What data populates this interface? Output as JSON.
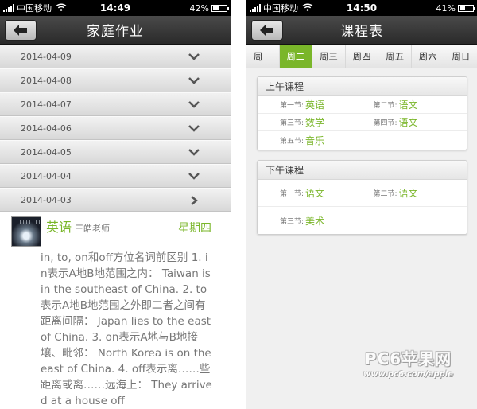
{
  "homework_screen": {
    "status": {
      "carrier": "中国移动",
      "time": "14:49",
      "battery": "42%",
      "battery_level": 0.42
    },
    "title": "家庭作业",
    "dates": [
      "2014-04-09",
      "2014-04-08",
      "2014-04-07",
      "2014-04-06",
      "2014-04-05",
      "2014-04-04",
      "2014-04-03"
    ],
    "detail": {
      "subject": "英语",
      "teacher": "王皓老师",
      "weekday": "星期四",
      "text": "in, to, on和off方位名词前区别 1. in表示A地B地范围之内： Taiwan is in the southeast of China. 2. to表示A地B地范围之外即二者之间有距离间隔： Japan lies to the east of China. 3. on表示A地与B地接壤、毗邻： North Korea is on the east of China. 4. off表示离……些距离或离……远海上： They arrived at a house off"
    }
  },
  "schedule_screen": {
    "status": {
      "carrier": "中国移动",
      "time": "14:50",
      "battery": "41%",
      "battery_level": 0.41
    },
    "title": "课程表",
    "weekdays": [
      "周一",
      "周二",
      "周三",
      "周四",
      "周五",
      "周六",
      "周日"
    ],
    "active_day": "周二",
    "morning": {
      "title": "上午课程",
      "p1_label": "第一节:",
      "p1": "英语",
      "p2_label": "第二节:",
      "p2": "语文",
      "p3_label": "第三节:",
      "p3": "数学",
      "p4_label": "第四节:",
      "p4": "语文",
      "p5_label": "第五节:",
      "p5": "音乐"
    },
    "afternoon": {
      "title": "下午课程",
      "p1_label": "第一节:",
      "p1": "语文",
      "p2_label": "第二节:",
      "p2": "语文",
      "p3_label": "第三节:",
      "p3": "美术"
    }
  },
  "watermark": {
    "main": "PC6苹果网",
    "sub": "www.pc6.com/apple"
  },
  "colors": {
    "accent_green": "#7ab62a",
    "navbar": "#3a3a3a",
    "status_bar": "#000000"
  },
  "icons": {
    "back": "back-arrow-icon",
    "chevron_down": "chevron-down-icon",
    "chevron_right": "chevron-right-icon",
    "wifi": "wifi-icon",
    "battery": "battery-icon"
  }
}
